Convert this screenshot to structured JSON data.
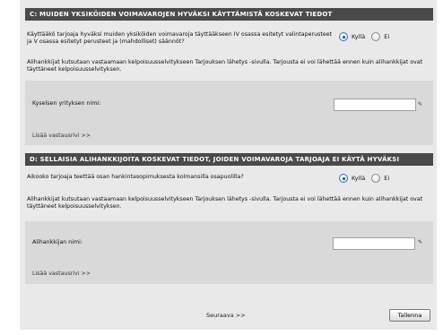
{
  "section_c": {
    "title": "C: MUIDEN YKSIKÖIDEN VOIMAVAROJEN HYVÄKSI KÄYTTÄMISTÄ KOSKEVAT TIEDOT",
    "question": "Käyttääkö tarjoaja hyväksi muiden yksiköiden voimavaroja täyttääkseen IV osassa esitetyt valintaperusteet ja V osassa esitetyt perusteet ja (mahdolliset) säännöt?",
    "option_yes": "Kyllä",
    "option_no": "Ei",
    "selected": "Kyllä",
    "info": "Alihankkijat kutsutaan vastaamaan kelpoisuusselvitykseen Tarjouksen lähetys -sivulla. Tarjousta ei voi lähettää ennen kuin alihankkijat ovat täyttäneet kelpoisuusselvityksen.",
    "field_label": "Kyselsen yrityksen nimi:",
    "field_value": "",
    "add_link": "Lisää vastausrivi >>"
  },
  "section_d": {
    "title": "D: SELLAISIA ALIHANKKIJOITA KOSKEVAT TIEDOT, JOIDEN VOIMAVAROJA TARJOAJA EI KÄYTÄ HYVÄKSI",
    "question": "Aikooko tarjoaja teettää osan hankintasopimuksesta kolmansilla osapuolilla?",
    "option_yes": "Kyllä",
    "option_no": "Ei",
    "selected": "Kyllä",
    "info": "Alihankkijat kutsutaan vastaamaan kelpoisuusselvitykseen Tarjouksen lähetys -sivulla. Tarjousta ei voi lähettää ennen kuin alihankkijat ovat täyttäneet kelpoisuusselvityksen.",
    "field_label": "Alihankkijan nimi:",
    "field_value": "",
    "add_link": "Lisää vastausrivi >>"
  },
  "footer": {
    "next_label": "Seuraava >>",
    "save_label": "Tallenna"
  }
}
